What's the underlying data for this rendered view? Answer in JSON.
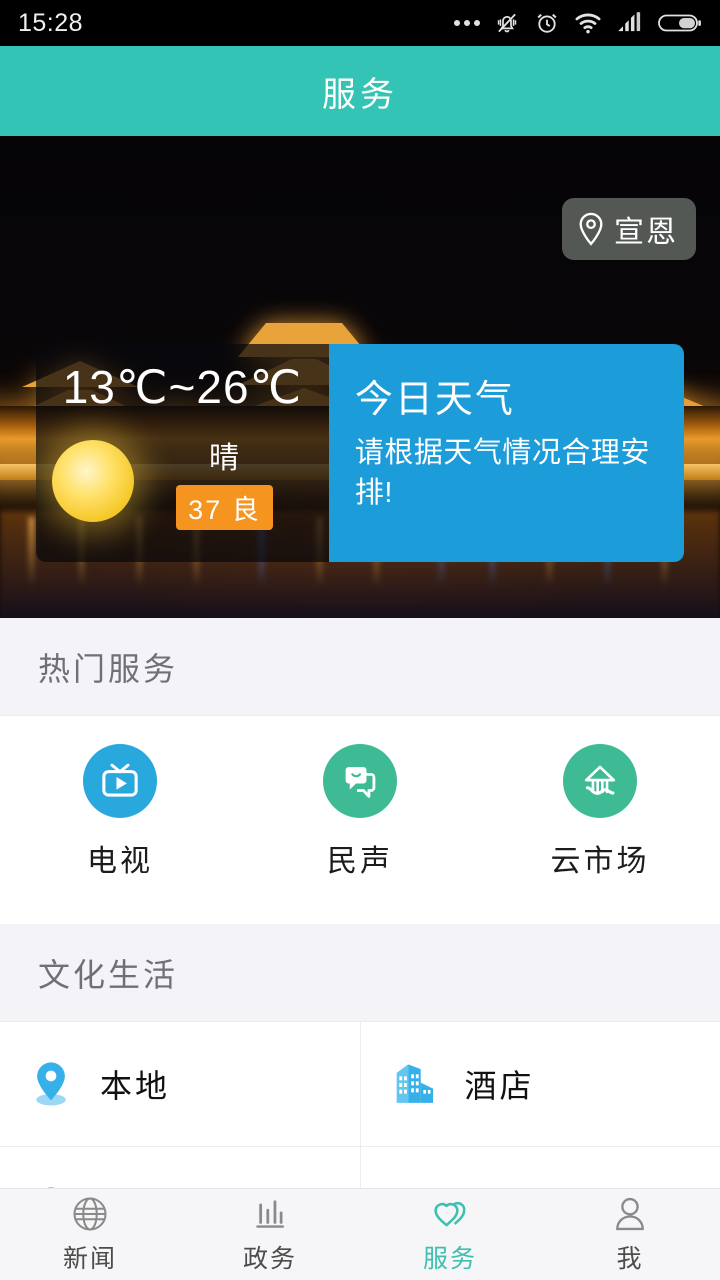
{
  "status_bar": {
    "time": "15:28",
    "icons": [
      "more-dots-icon",
      "silent-bell-icon",
      "alarm-clock-icon",
      "wifi-icon",
      "signal-bars-icon",
      "battery-icon"
    ]
  },
  "header": {
    "title": "服务"
  },
  "hero": {
    "location_pill": {
      "label": "宣恩",
      "icon": "location-pin-icon"
    },
    "image_description": "night-view-of-illuminated-wind-rain-bridge"
  },
  "weather": {
    "temperature_range": "13℃~26℃",
    "condition": "晴",
    "condition_icon": "sun-icon",
    "aqi": "37 良",
    "aqi_color": "#f5941f",
    "panel_title": "今日天气",
    "panel_desc": "请根据天气情况合理安排!",
    "panel_color": "#1c9cd8"
  },
  "sections": [
    {
      "title": "热门服务",
      "items": [
        {
          "label": "电视",
          "icon": "tv-play-icon",
          "color": "#29a8de"
        },
        {
          "label": "民声",
          "icon": "chat-bubble-icon",
          "color": "#3ebb95"
        },
        {
          "label": "云市场",
          "icon": "cloud-market-icon",
          "color": "#3ebb95"
        }
      ]
    },
    {
      "title": "文化生活",
      "items": [
        {
          "label": "本地",
          "icon": "location-pin-icon",
          "color": "#36b0e8"
        },
        {
          "label": "酒店",
          "icon": "buildings-icon",
          "color": "#36b0e8"
        },
        {
          "label": "",
          "icon": "location-pin-icon",
          "color": "#36b0e8"
        },
        {
          "label": "",
          "icon": "mountains-icon",
          "color": "#36b0e8"
        }
      ]
    }
  ],
  "tabbar": {
    "active_color": "#3fc0af",
    "tabs": [
      {
        "label": "新闻",
        "icon": "globe-icon",
        "active": false
      },
      {
        "label": "政务",
        "icon": "bar-chart-icon",
        "active": false
      },
      {
        "label": "服务",
        "icon": "double-heart-icon",
        "active": true
      },
      {
        "label": "我",
        "icon": "person-icon",
        "active": false
      }
    ]
  }
}
